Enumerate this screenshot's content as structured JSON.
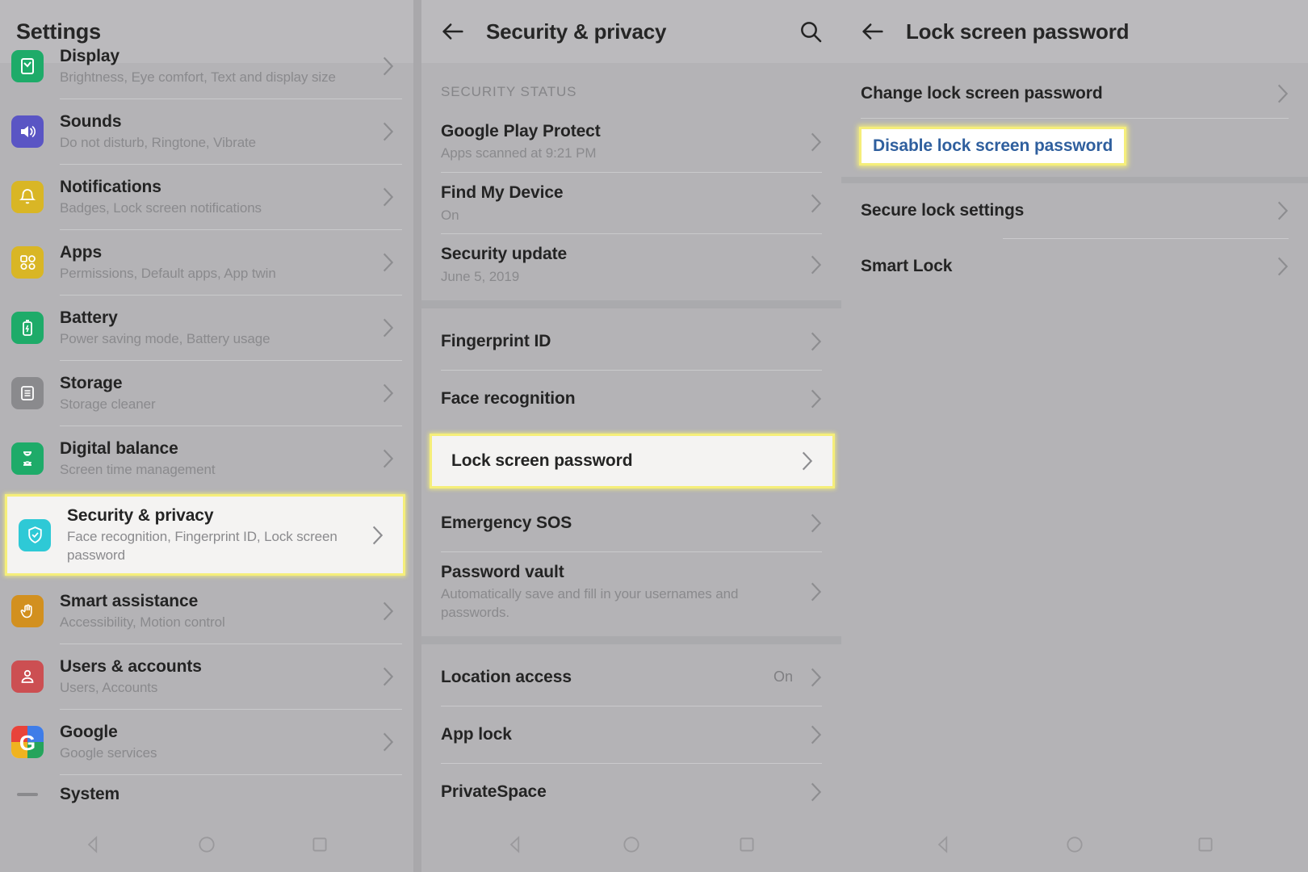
{
  "panels": {
    "settings": {
      "header": {
        "title": "Settings"
      },
      "items": [
        {
          "title": "Display",
          "sub": "Brightness, Eye comfort, Text and display size",
          "icon": "display-icon",
          "color": "#1eab69",
          "clipped": true
        },
        {
          "title": "Sounds",
          "sub": "Do not disturb, Ringtone, Vibrate",
          "icon": "sounds-icon",
          "color": "#5a55c4"
        },
        {
          "title": "Notifications",
          "sub": "Badges, Lock screen notifications",
          "icon": "notifications-icon",
          "color": "#d9b625"
        },
        {
          "title": "Apps",
          "sub": "Permissions, Default apps, App twin",
          "icon": "apps-icon",
          "color": "#d9b625"
        },
        {
          "title": "Battery",
          "sub": "Power saving mode, Battery usage",
          "icon": "battery-icon",
          "color": "#1eab69"
        },
        {
          "title": "Storage",
          "sub": "Storage cleaner",
          "icon": "storage-icon",
          "color": "#8a8a8d"
        },
        {
          "title": "Digital balance",
          "sub": "Screen time management",
          "icon": "hourglass-icon",
          "color": "#1eab69"
        },
        {
          "title": "Security & privacy",
          "sub": "Face recognition, Fingerprint ID, Lock screen password",
          "icon": "shield-check-icon",
          "color": "#2ec9d6",
          "highlighted": true
        },
        {
          "title": "Smart assistance",
          "sub": "Accessibility, Motion control",
          "icon": "hand-icon",
          "color": "#d2901f"
        },
        {
          "title": "Users & accounts",
          "sub": "Users, Accounts",
          "icon": "user-icon",
          "color": "#cc4f52"
        },
        {
          "title": "Google",
          "sub": "Google services",
          "icon": "google-icon",
          "color": "#ffffff"
        },
        {
          "title": "System",
          "sub": "",
          "icon": "system-icon",
          "color": "#8a8a8d"
        }
      ]
    },
    "security": {
      "header": {
        "title": "Security & privacy",
        "back": "back-arrow-icon",
        "search": "search-icon"
      },
      "section_label": "SECURITY STATUS",
      "group1": [
        {
          "title": "Google Play Protect",
          "sub": "Apps scanned at 9:21 PM"
        },
        {
          "title": "Find My Device",
          "sub": "On"
        },
        {
          "title": "Security update",
          "sub": "June 5, 2019"
        }
      ],
      "group2": [
        {
          "title": "Fingerprint ID",
          "sub": ""
        },
        {
          "title": "Face recognition",
          "sub": ""
        },
        {
          "title": "Lock screen password",
          "sub": "",
          "highlighted": true
        },
        {
          "title": "Emergency SOS",
          "sub": ""
        },
        {
          "title": "Password vault",
          "sub": "Automatically save and fill in your usernames and passwords."
        }
      ],
      "group3": [
        {
          "title": "Location access",
          "sub": "",
          "value": "On"
        },
        {
          "title": "App lock",
          "sub": ""
        },
        {
          "title": "PrivateSpace",
          "sub": ""
        }
      ]
    },
    "lockscreen": {
      "header": {
        "title": "Lock screen password",
        "back": "back-arrow-icon"
      },
      "items": [
        {
          "title": "Change lock screen password",
          "type": "row"
        },
        {
          "title": "Disable lock screen password",
          "type": "link",
          "highlighted": true
        },
        {
          "title": "Secure lock settings",
          "type": "row"
        },
        {
          "title": "Smart Lock",
          "type": "row"
        }
      ]
    }
  },
  "navbar": {
    "back": "back-triangle-icon",
    "home": "home-circle-icon",
    "recents": "recents-square-icon"
  },
  "colors": {
    "background": "#b4b3b6",
    "header": "#bbbabd",
    "highlight_border": "#f5ee7a",
    "highlight_fill": "#f4f3f2",
    "link_text": "#2f5f9e",
    "title_text": "#242424",
    "sub_text": "#8a8a8d"
  }
}
